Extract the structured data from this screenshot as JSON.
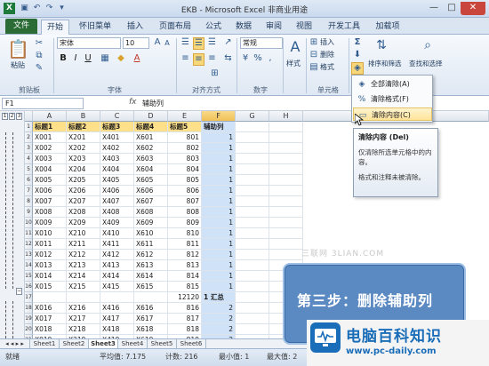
{
  "window": {
    "title": "EKB - Microsoft Excel 非商业用途",
    "app_icon": "X",
    "controls": [
      "—",
      "□",
      "✕"
    ]
  },
  "quick_access": {
    "icons": [
      "save-icon",
      "undo-icon",
      "redo-icon",
      "customize-icon"
    ]
  },
  "tabs": [
    "文件",
    "开始",
    "怀旧菜单",
    "插入",
    "页面布局",
    "公式",
    "数据",
    "审阅",
    "视图",
    "开发工具",
    "加载项"
  ],
  "active_tab": "开始",
  "ribbon": {
    "clipboard": {
      "paste_label": "粘贴",
      "group_label": "剪贴板"
    },
    "font": {
      "name": "宋体",
      "size": "10",
      "bold": "B",
      "italic": "I",
      "underline": "U",
      "grow": "A",
      "shrink": "A",
      "fontcolor": "A",
      "group_label": "字体"
    },
    "alignment": {
      "group_label": "对齐方式"
    },
    "number": {
      "format": "常规",
      "currency": "%",
      "group_label": "数字"
    },
    "styles": {
      "label": "样式"
    },
    "cells": {
      "insert": "插入",
      "delete": "删除",
      "format": "格式",
      "group_label": "单元格"
    },
    "editing": {
      "sum": "Σ",
      "sort_filter": "排序和筛选",
      "find_select": "查找和选择"
    }
  },
  "formula_bar": {
    "name_box": "F1",
    "fx": "fx",
    "value": "辅助列"
  },
  "outline": {
    "levels": [
      "1",
      "2",
      "3"
    ],
    "minus": "−"
  },
  "columns": [
    "A",
    "B",
    "C",
    "D",
    "E",
    "F",
    "G",
    "H"
  ],
  "header_row": {
    "row": "1",
    "cells": [
      "标题1",
      "标题2",
      "标题3",
      "标题4",
      "标题5",
      "辅助列"
    ]
  },
  "rows": [
    {
      "r": "2",
      "a": "X001",
      "b": "X201",
      "c": "X401",
      "d": "X601",
      "e": "801",
      "f": "1"
    },
    {
      "r": "3",
      "a": "X002",
      "b": "X202",
      "c": "X402",
      "d": "X602",
      "e": "802",
      "f": "1"
    },
    {
      "r": "4",
      "a": "X003",
      "b": "X203",
      "c": "X403",
      "d": "X603",
      "e": "803",
      "f": "1"
    },
    {
      "r": "5",
      "a": "X004",
      "b": "X204",
      "c": "X404",
      "d": "X604",
      "e": "804",
      "f": "1"
    },
    {
      "r": "6",
      "a": "X005",
      "b": "X205",
      "c": "X405",
      "d": "X605",
      "e": "805",
      "f": "1"
    },
    {
      "r": "7",
      "a": "X006",
      "b": "X206",
      "c": "X406",
      "d": "X606",
      "e": "806",
      "f": "1"
    },
    {
      "r": "8",
      "a": "X007",
      "b": "X207",
      "c": "X407",
      "d": "X607",
      "e": "807",
      "f": "1"
    },
    {
      "r": "9",
      "a": "X008",
      "b": "X208",
      "c": "X408",
      "d": "X608",
      "e": "808",
      "f": "1"
    },
    {
      "r": "10",
      "a": "X009",
      "b": "X209",
      "c": "X409",
      "d": "X609",
      "e": "809",
      "f": "1"
    },
    {
      "r": "11",
      "a": "X010",
      "b": "X210",
      "c": "X410",
      "d": "X610",
      "e": "810",
      "f": "1"
    },
    {
      "r": "12",
      "a": "X011",
      "b": "X211",
      "c": "X411",
      "d": "X611",
      "e": "811",
      "f": "1"
    },
    {
      "r": "13",
      "a": "X012",
      "b": "X212",
      "c": "X412",
      "d": "X612",
      "e": "812",
      "f": "1"
    },
    {
      "r": "14",
      "a": "X013",
      "b": "X213",
      "c": "X413",
      "d": "X613",
      "e": "813",
      "f": "1"
    },
    {
      "r": "15",
      "a": "X014",
      "b": "X214",
      "c": "X414",
      "d": "X614",
      "e": "814",
      "f": "1"
    },
    {
      "r": "16",
      "a": "X015",
      "b": "X215",
      "c": "X415",
      "d": "X615",
      "e": "815",
      "f": "1"
    },
    {
      "r": "17",
      "a": "",
      "b": "",
      "c": "",
      "d": "",
      "e": "12120",
      "f": "1 汇总"
    },
    {
      "r": "18",
      "a": "X016",
      "b": "X216",
      "c": "X416",
      "d": "X616",
      "e": "816",
      "f": "2"
    },
    {
      "r": "19",
      "a": "X017",
      "b": "X217",
      "c": "X417",
      "d": "X617",
      "e": "817",
      "f": "2"
    },
    {
      "r": "20",
      "a": "X018",
      "b": "X218",
      "c": "X418",
      "d": "X618",
      "e": "818",
      "f": "2"
    },
    {
      "r": "21",
      "a": "X019",
      "b": "X219",
      "c": "X419",
      "d": "X619",
      "e": "819",
      "f": "2"
    }
  ],
  "sheet_tabs": [
    "Sheet1",
    "Sheet2",
    "Sheet3",
    "Sheet4",
    "Sheet5",
    "Sheet6"
  ],
  "active_sheet": "Sheet3",
  "status": {
    "mode": "就绪",
    "average": "平均值: 7.175",
    "count": "计数: 216",
    "min": "最小值: 1",
    "max": "最大值: 2"
  },
  "clear_menu": {
    "items": [
      {
        "label": "全部清除(A)",
        "icon": "eraser-all-icon"
      },
      {
        "label": "清除格式(F)",
        "icon": "clear-format-icon"
      },
      {
        "label": "清除内容(C)",
        "icon": "clear-contents-icon"
      }
    ]
  },
  "tooltip": {
    "title": "清除内容 (Del)",
    "body": "仅清除所选单元格中的内容。",
    "note": "格式和注释未被清除。"
  },
  "step_caption": "第三步：删除辅助列",
  "watermark": "三联网 3LIAN.COM",
  "logo": {
    "name": "电脑百科知识",
    "url": "www.pc-daily.com"
  }
}
